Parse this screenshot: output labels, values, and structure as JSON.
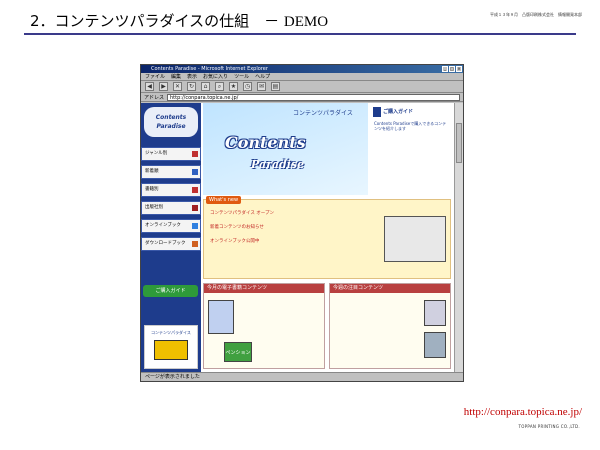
{
  "slide": {
    "title_prefix": "2．コンテンツパラダイスの仕組　－",
    "title_demo": "DEMO",
    "header_meta": "平成１３年９月　凸版印刷株式会社　情報開発本部"
  },
  "browser": {
    "window_title": "Contents Paradise - Microsoft Internet Explorer",
    "menu_items": [
      "ファイル",
      "編集",
      "表示",
      "お気に入り",
      "ツール",
      "ヘルプ"
    ],
    "toolbar_icons": [
      "back-icon",
      "forward-icon",
      "stop-icon",
      "refresh-icon",
      "home-icon",
      "search-icon",
      "favorites-icon",
      "history-icon",
      "mail-icon",
      "print-icon"
    ],
    "address_label": "アドレス",
    "address_value": "http://conpara.topica.ne.jp/",
    "status_text": "ページが表示されました"
  },
  "site": {
    "logo_text": "Contents Paradise",
    "banner_caption": "コンテンツパラダイス",
    "banner_logo_1": "Contents",
    "banner_logo_2": "Paradise",
    "guide_header": "ご購入ガイド",
    "guide_text": "Contents Paradiseで購入できるコンテンツを紹介します",
    "side_menu": [
      "ジャンル別",
      "新着順",
      "書籍別",
      "出版社別",
      "オンラインブック",
      "ダウンロードブック"
    ],
    "side_guide": "ご購入ガイド",
    "side_promo": "コンテンツパラダイス",
    "whatsnew_tag": "What's new",
    "whatsnew_lines": [
      "コンテンツパラダイス オープン",
      "新着コンテンツのお知らせ",
      "オンラインブック公開中"
    ],
    "col_left_header": "今月の電子書籍コンテンツ",
    "col_right_header": "今週の注目コンテンツ",
    "col_left_badge": "ペンション"
  },
  "footer": {
    "url": "http://conpara.topica.ne.jp/",
    "company": "TOPPAN PRINTING CO.,LTD."
  }
}
